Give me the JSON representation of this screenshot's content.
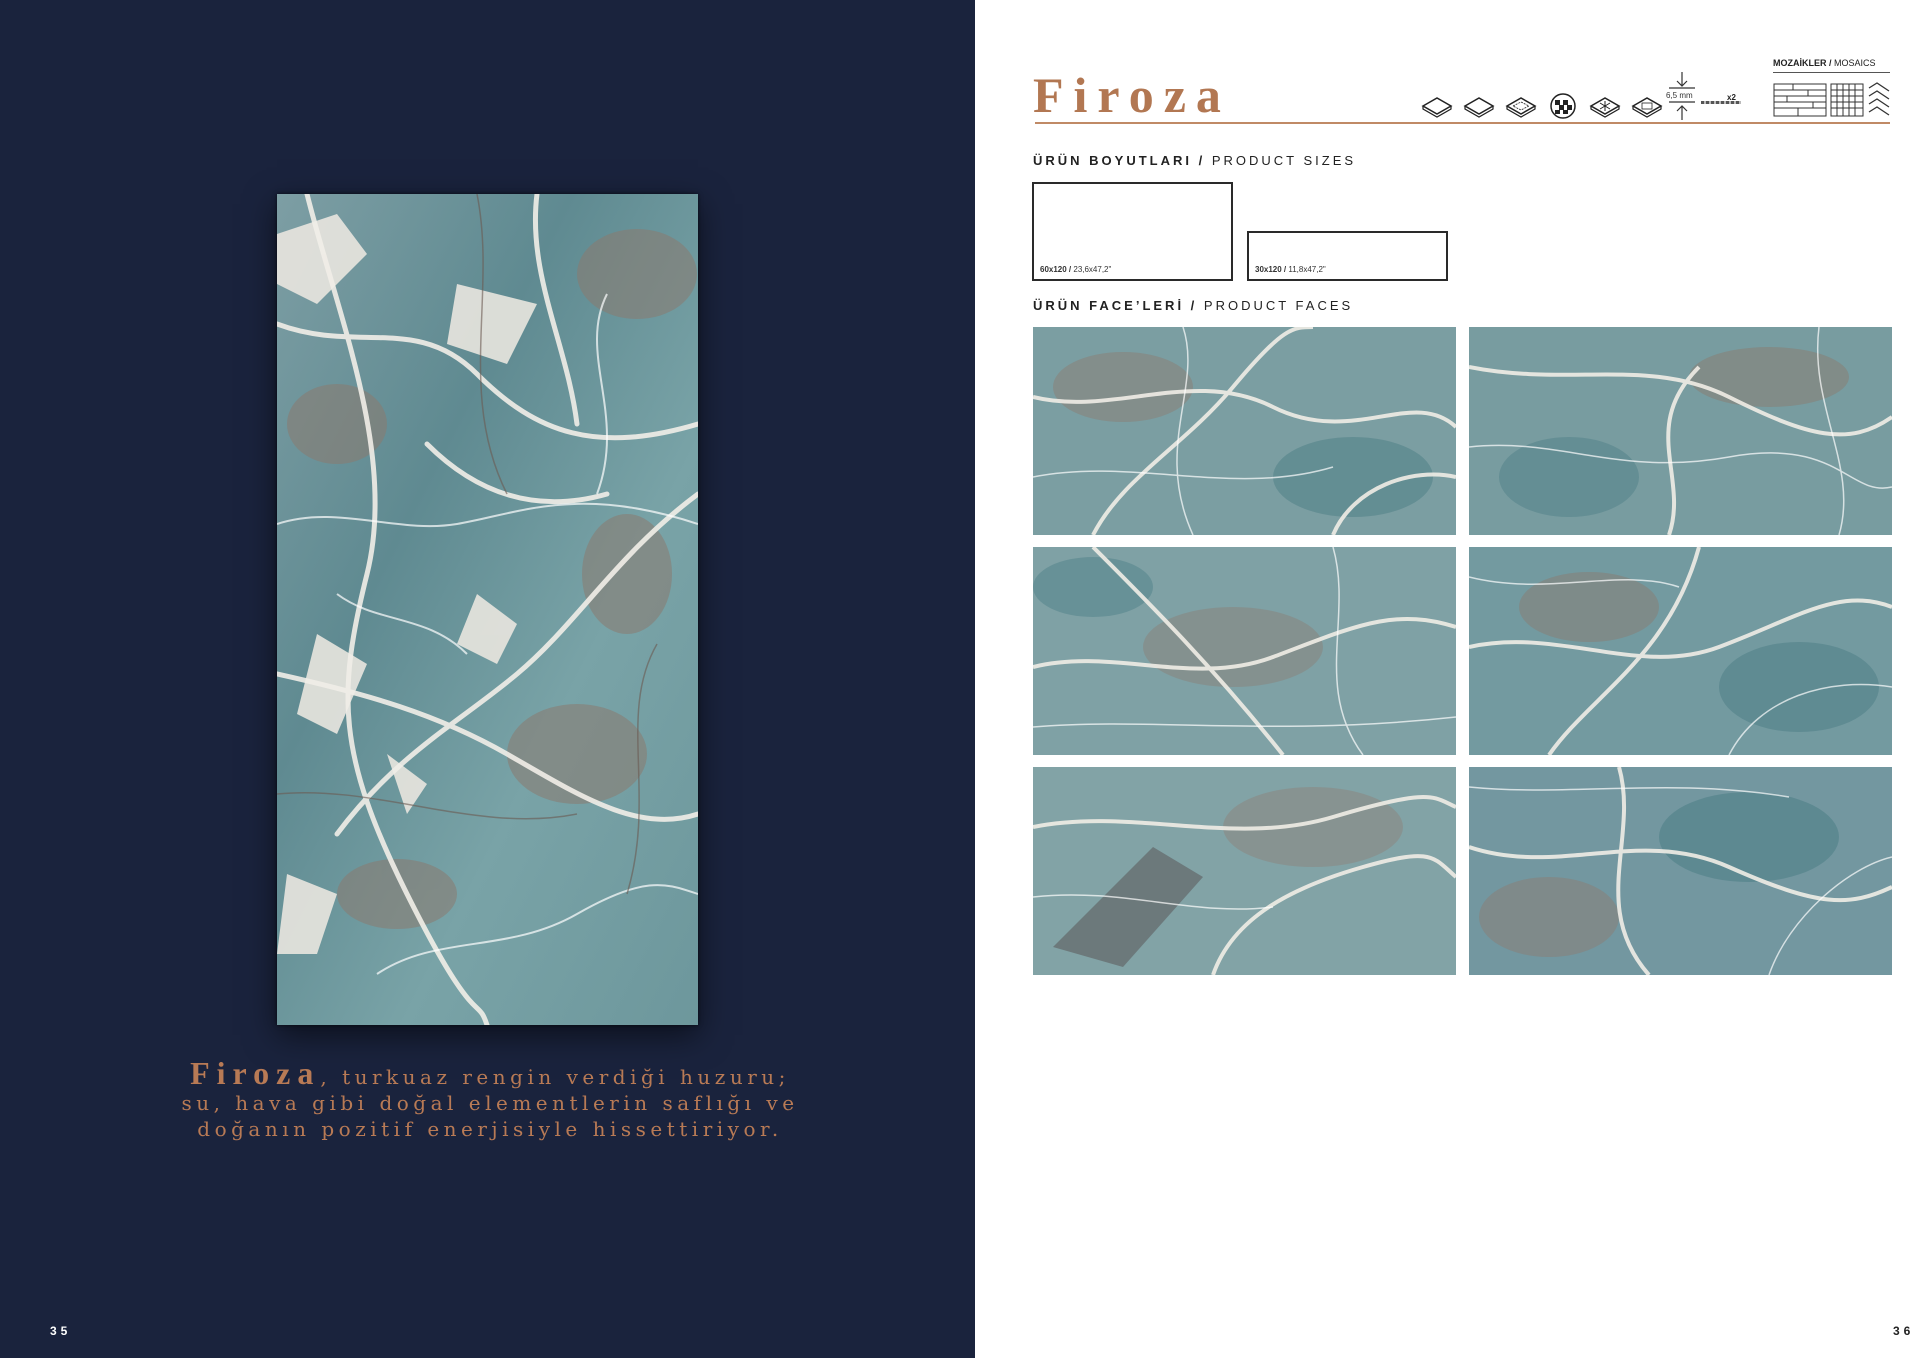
{
  "left_page": {
    "tagline_brand": "Firoza",
    "tagline_line1_rest": ", turkuaz rengin verdiği huzuru;",
    "tagline_line2": "su, hava gibi doğal elementlerin saflığı ve",
    "tagline_line3": "doğanın pozitif enerjisiyle hissettiriyor.",
    "page_number": "35"
  },
  "right_page": {
    "title": "Firoza",
    "thickness_label": "6,5 mm",
    "x2_label": "x2",
    "mosaics_tr": "MOZAİKLER /",
    "mosaics_en": " MOSAICS",
    "sizes_heading_tr": "ÜRÜN BOYUTLARI /",
    "sizes_heading_en": " PRODUCT SIZES",
    "sizes": [
      {
        "metric": "60x120 /",
        "imperial": " 23,6x47,2\""
      },
      {
        "metric": "30x120 /",
        "imperial": " 11,8x47,2\""
      }
    ],
    "faces_heading_tr": "ÜRÜN FACE’LERİ /",
    "faces_heading_en": " PRODUCT FACES",
    "page_number": "36"
  },
  "icons": [
    "glossy-tile-icon",
    "matt-tile-icon",
    "textured-tile-icon",
    "random-faces-icon",
    "frost-resistant-icon",
    "rectified-icon"
  ],
  "colors": {
    "navy_background": "#1a233d",
    "copper_accent": "#b27752",
    "marble_teal": "#6f9aa0"
  }
}
